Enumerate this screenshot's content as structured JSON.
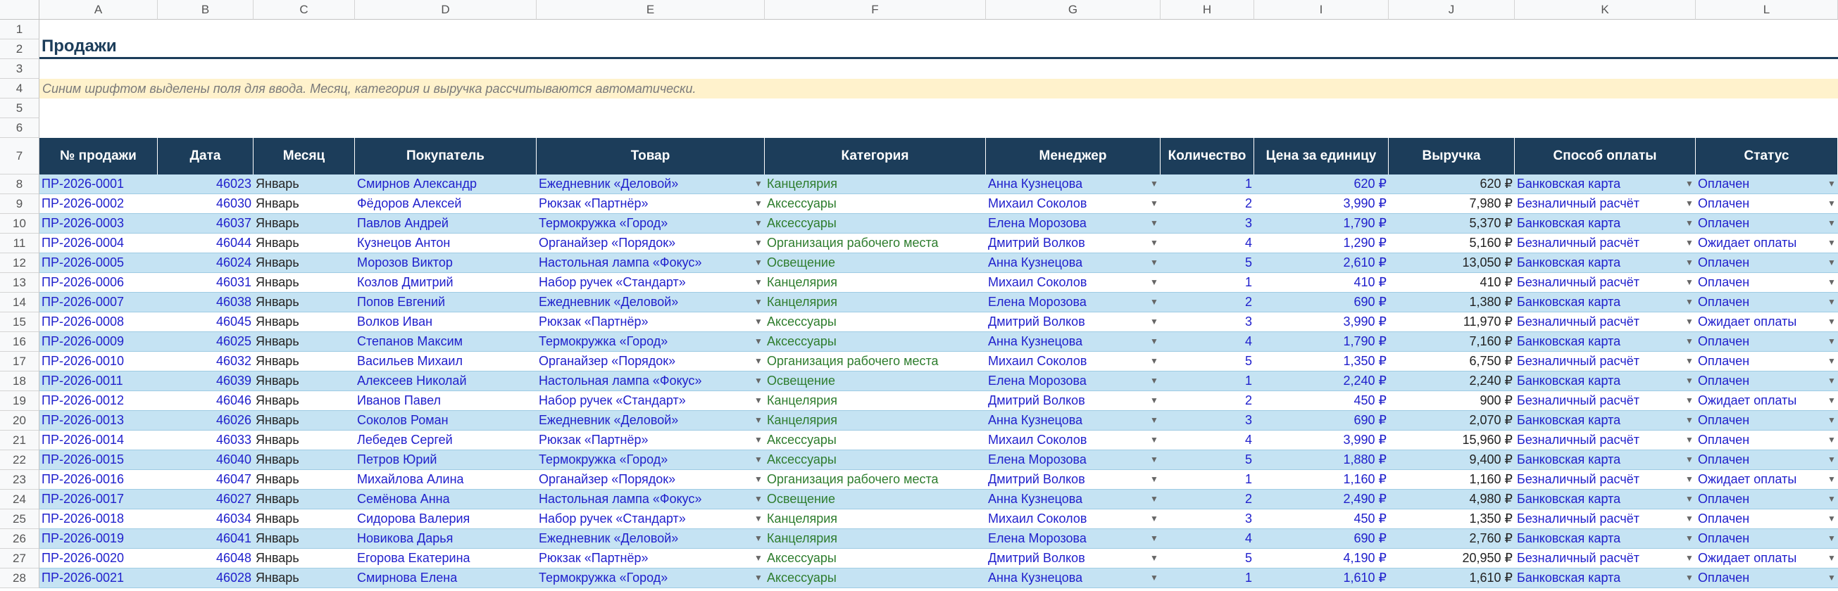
{
  "sheet": {
    "columns": [
      "A",
      "B",
      "C",
      "D",
      "E",
      "F",
      "G",
      "H",
      "I",
      "J",
      "K",
      "L"
    ],
    "row_numbers": [
      "1",
      "2",
      "3",
      "4",
      "5",
      "6",
      "7",
      "8",
      "9",
      "10",
      "11",
      "12",
      "13",
      "14",
      "15",
      "16",
      "17",
      "18",
      "19",
      "20",
      "21",
      "22",
      "23",
      "24",
      "25",
      "26",
      "27",
      "28"
    ],
    "title": "Продажи",
    "note": "Синим шрифтом выделены поля для ввода. Месяц, категория и выручка рассчитываются автоматически.",
    "headers": [
      "№ продажи",
      "Дата",
      "Месяц",
      "Покупатель",
      "Товар",
      "Категория",
      "Менеджер",
      "Количество",
      "Цена за единицу",
      "Выручка",
      "Способ оплаты",
      "Статус"
    ],
    "colors": {
      "header_bg": "#1c3d5a",
      "band": "#c5e3f3",
      "note_bg": "#fff2cc",
      "input_text": "#1f1fcc",
      "category_text": "#2e7d2e"
    },
    "rows": [
      [
        "ПР-2026-0001",
        "46023",
        "Январь",
        "Смирнов Александр",
        "Ежедневник «Деловой»",
        "Канцелярия",
        "Анна Кузнецова",
        "1",
        "620 ₽",
        "620 ₽",
        "Банковская карта",
        "Оплачен"
      ],
      [
        "ПР-2026-0002",
        "46030",
        "Январь",
        "Фёдоров Алексей",
        "Рюкзак «Партнёр»",
        "Аксессуары",
        "Михаил Соколов",
        "2",
        "3,990 ₽",
        "7,980 ₽",
        "Безналичный расчёт",
        "Оплачен"
      ],
      [
        "ПР-2026-0003",
        "46037",
        "Январь",
        "Павлов Андрей",
        "Термокружка «Город»",
        "Аксессуары",
        "Елена Морозова",
        "3",
        "1,790 ₽",
        "5,370 ₽",
        "Банковская карта",
        "Оплачен"
      ],
      [
        "ПР-2026-0004",
        "46044",
        "Январь",
        "Кузнецов Антон",
        "Органайзер «Порядок»",
        "Организация рабочего места",
        "Дмитрий Волков",
        "4",
        "1,290 ₽",
        "5,160 ₽",
        "Безналичный расчёт",
        "Ожидает оплаты"
      ],
      [
        "ПР-2026-0005",
        "46024",
        "Январь",
        "Морозов Виктор",
        "Настольная лампа «Фокус»",
        "Освещение",
        "Анна Кузнецова",
        "5",
        "2,610 ₽",
        "13,050 ₽",
        "Банковская карта",
        "Оплачен"
      ],
      [
        "ПР-2026-0006",
        "46031",
        "Январь",
        "Козлов Дмитрий",
        "Набор ручек «Стандарт»",
        "Канцелярия",
        "Михаил Соколов",
        "1",
        "410 ₽",
        "410 ₽",
        "Безналичный расчёт",
        "Оплачен"
      ],
      [
        "ПР-2026-0007",
        "46038",
        "Январь",
        "Попов Евгений",
        "Ежедневник «Деловой»",
        "Канцелярия",
        "Елена Морозова",
        "2",
        "690 ₽",
        "1,380 ₽",
        "Банковская карта",
        "Оплачен"
      ],
      [
        "ПР-2026-0008",
        "46045",
        "Январь",
        "Волков Иван",
        "Рюкзак «Партнёр»",
        "Аксессуары",
        "Дмитрий Волков",
        "3",
        "3,990 ₽",
        "11,970 ₽",
        "Безналичный расчёт",
        "Ожидает оплаты"
      ],
      [
        "ПР-2026-0009",
        "46025",
        "Январь",
        "Степанов Максим",
        "Термокружка «Город»",
        "Аксессуары",
        "Анна Кузнецова",
        "4",
        "1,790 ₽",
        "7,160 ₽",
        "Банковская карта",
        "Оплачен"
      ],
      [
        "ПР-2026-0010",
        "46032",
        "Январь",
        "Васильев Михаил",
        "Органайзер «Порядок»",
        "Организация рабочего места",
        "Михаил Соколов",
        "5",
        "1,350 ₽",
        "6,750 ₽",
        "Безналичный расчёт",
        "Оплачен"
      ],
      [
        "ПР-2026-0011",
        "46039",
        "Январь",
        "Алексеев Николай",
        "Настольная лампа «Фокус»",
        "Освещение",
        "Елена Морозова",
        "1",
        "2,240 ₽",
        "2,240 ₽",
        "Банковская карта",
        "Оплачен"
      ],
      [
        "ПР-2026-0012",
        "46046",
        "Январь",
        "Иванов Павел",
        "Набор ручек «Стандарт»",
        "Канцелярия",
        "Дмитрий Волков",
        "2",
        "450 ₽",
        "900 ₽",
        "Безналичный расчёт",
        "Ожидает оплаты"
      ],
      [
        "ПР-2026-0013",
        "46026",
        "Январь",
        "Соколов Роман",
        "Ежедневник «Деловой»",
        "Канцелярия",
        "Анна Кузнецова",
        "3",
        "690 ₽",
        "2,070 ₽",
        "Банковская карта",
        "Оплачен"
      ],
      [
        "ПР-2026-0014",
        "46033",
        "Январь",
        "Лебедев Сергей",
        "Рюкзак «Партнёр»",
        "Аксессуары",
        "Михаил Соколов",
        "4",
        "3,990 ₽",
        "15,960 ₽",
        "Безналичный расчёт",
        "Оплачен"
      ],
      [
        "ПР-2026-0015",
        "46040",
        "Январь",
        "Петров Юрий",
        "Термокружка «Город»",
        "Аксессуары",
        "Елена Морозова",
        "5",
        "1,880 ₽",
        "9,400 ₽",
        "Банковская карта",
        "Оплачен"
      ],
      [
        "ПР-2026-0016",
        "46047",
        "Январь",
        "Михайлова Алина",
        "Органайзер «Порядок»",
        "Организация рабочего места",
        "Дмитрий Волков",
        "1",
        "1,160 ₽",
        "1,160 ₽",
        "Безналичный расчёт",
        "Ожидает оплаты"
      ],
      [
        "ПР-2026-0017",
        "46027",
        "Январь",
        "Семёнова Анна",
        "Настольная лампа «Фокус»",
        "Освещение",
        "Анна Кузнецова",
        "2",
        "2,490 ₽",
        "4,980 ₽",
        "Банковская карта",
        "Оплачен"
      ],
      [
        "ПР-2026-0018",
        "46034",
        "Январь",
        "Сидорова Валерия",
        "Набор ручек «Стандарт»",
        "Канцелярия",
        "Михаил Соколов",
        "3",
        "450 ₽",
        "1,350 ₽",
        "Безналичный расчёт",
        "Оплачен"
      ],
      [
        "ПР-2026-0019",
        "46041",
        "Январь",
        "Новикова Дарья",
        "Ежедневник «Деловой»",
        "Канцелярия",
        "Елена Морозова",
        "4",
        "690 ₽",
        "2,760 ₽",
        "Банковская карта",
        "Оплачен"
      ],
      [
        "ПР-2026-0020",
        "46048",
        "Январь",
        "Егорова Екатерина",
        "Рюкзак «Партнёр»",
        "Аксессуары",
        "Дмитрий Волков",
        "5",
        "4,190 ₽",
        "20,950 ₽",
        "Безналичный расчёт",
        "Ожидает оплаты"
      ],
      [
        "ПР-2026-0021",
        "46028",
        "Январь",
        "Смирнова Елена",
        "Термокружка «Город»",
        "Аксессуары",
        "Анна Кузнецова",
        "1",
        "1,610 ₽",
        "1,610 ₽",
        "Банковская карта",
        "Оплачен"
      ]
    ]
  }
}
